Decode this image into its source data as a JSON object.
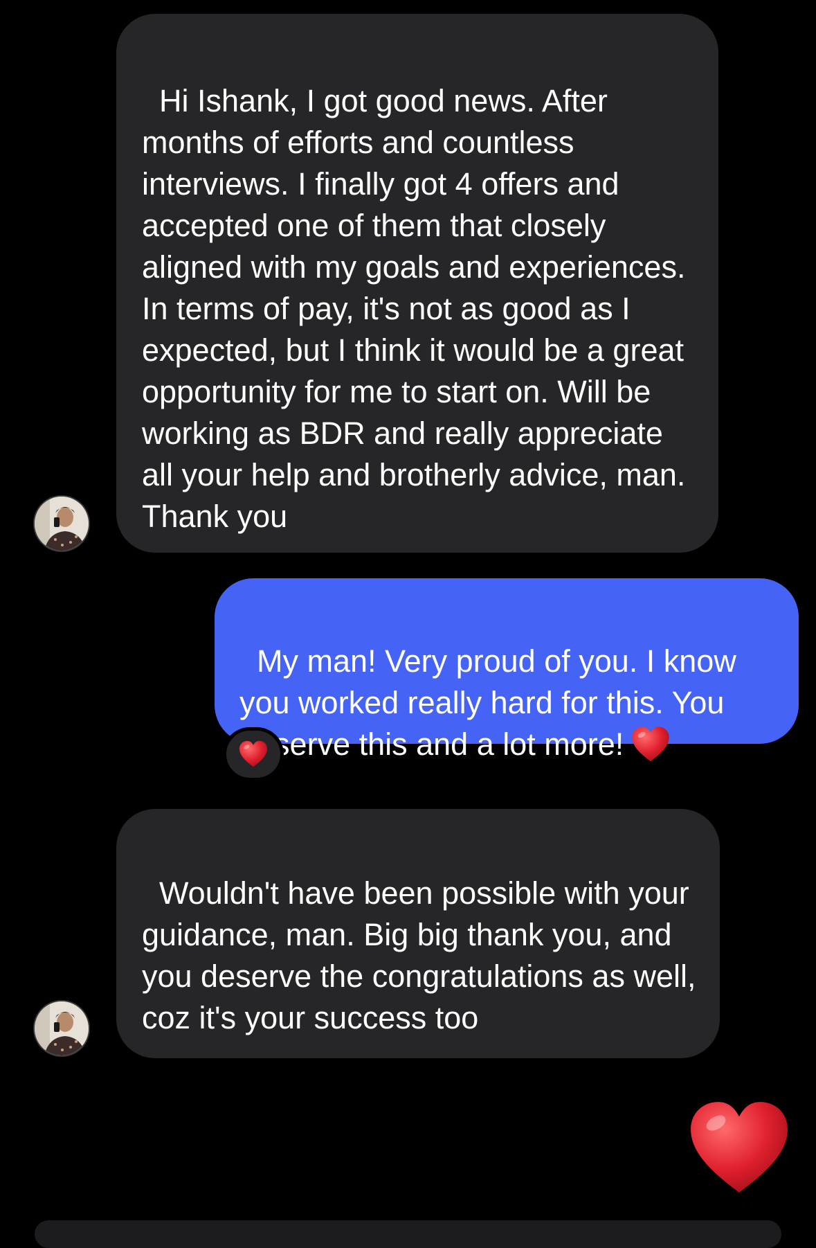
{
  "thread": {
    "messages": [
      {
        "sender": "contact",
        "text": "Hi Ishank, I got good news. After months of efforts and countless interviews. I finally got 4 offers and accepted one of them that closely aligned with my goals and experiences. In terms of pay, it's not as good as I  expected, but I think it would be a great opportunity for me to start on. Will be working as BDR and really appreciate all your help and brotherly advice, man. Thank you"
      },
      {
        "sender": "me",
        "text": "My man! Very proud of you. I know you worked really hard for this. You deserve this and a lot more!",
        "trailing_emoji": "heart-icon",
        "reaction": "heart-icon"
      },
      {
        "sender": "contact",
        "text": "Wouldn't have been possible with your guidance, man. Big big thank you, and you deserve the congratulations as well, coz it's your success too"
      },
      {
        "sender": "me",
        "emoji_message": "heart-icon"
      }
    ]
  },
  "colors": {
    "background": "#000000",
    "incoming_bubble": "#262628",
    "outgoing_bubble": "#4563f5",
    "text": "#ffffff",
    "heart": "#e0202e"
  }
}
